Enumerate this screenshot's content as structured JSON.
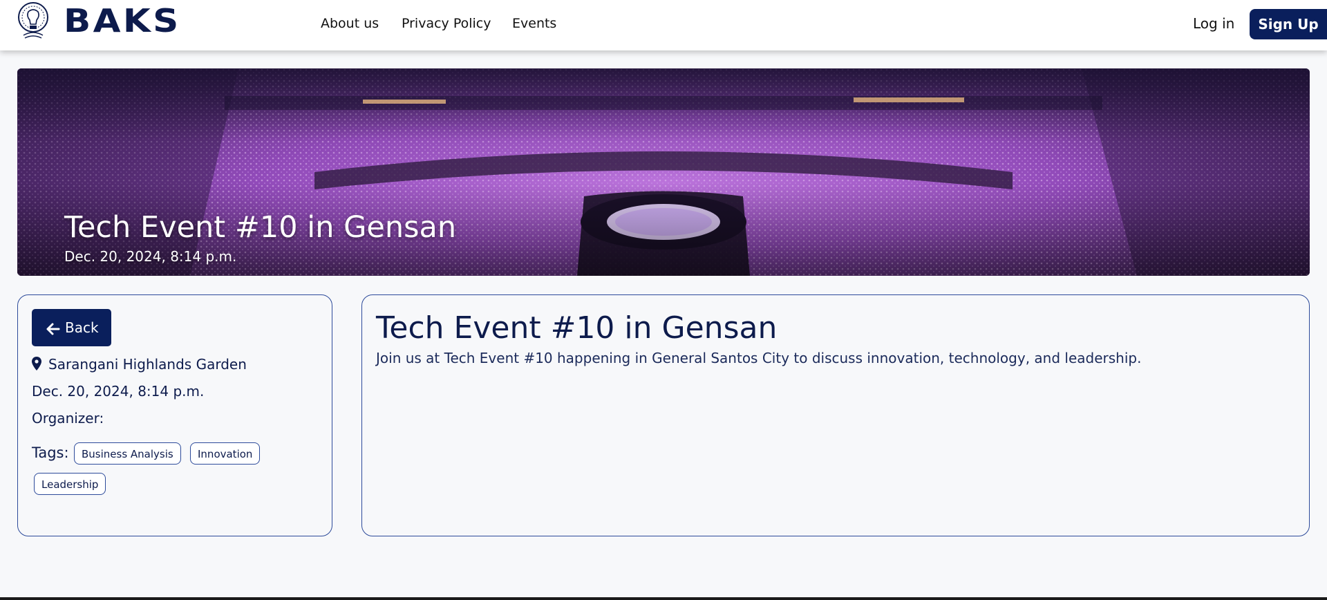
{
  "brand": {
    "name": "BAKS"
  },
  "nav": {
    "links": [
      "About us",
      "Privacy Policy",
      "Events"
    ],
    "login": "Log in",
    "signup": "Sign Up"
  },
  "hero": {
    "title": "Tech Event #10 in Gensan",
    "date": "Dec. 20, 2024, 8:14 p.m."
  },
  "sidebar": {
    "back_label": "Back",
    "location": "Sarangani Highlands Garden",
    "date": "Dec. 20, 2024, 8:14 p.m.",
    "organizer_label": "Organizer:",
    "tags_label": "Tags:",
    "tags": [
      "Business Analysis",
      "Innovation",
      "Leadership"
    ]
  },
  "main": {
    "title": "Tech Event #10 in Gensan",
    "description": "Join us at Tech Event #10 happening in General Santos City to discuss innovation, technology, and leadership."
  },
  "colors": {
    "primary": "#0a1f5c",
    "border": "#2c4a9a",
    "background": "#f7f8fa"
  },
  "icons": [
    "logo-emblem",
    "arrow-left-icon",
    "map-pin-icon"
  ]
}
